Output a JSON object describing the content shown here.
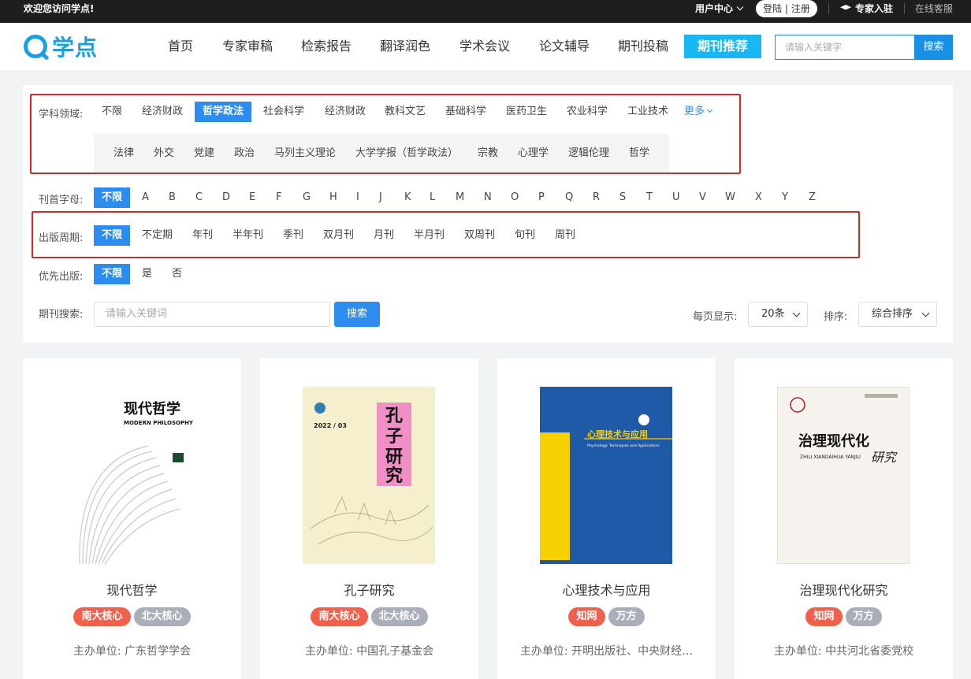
{
  "topbar": {
    "welcome": "欢迎您访问学点!",
    "user_center": "用户中心",
    "login": "登陆",
    "register": "注册",
    "expert_join": "专家入驻",
    "online_service": "在线客服"
  },
  "header": {
    "logo": "学点",
    "nav": [
      "首页",
      "专家审稿",
      "检索报告",
      "翻译润色",
      "学术会议",
      "论文辅导",
      "期刊投稿",
      "期刊推荐"
    ],
    "search_placeholder": "请输入关键字",
    "search_button": "搜索"
  },
  "filters": {
    "subject": {
      "label": "学科领域:",
      "options": [
        "不限",
        "经济财政",
        "哲学政法",
        "社会科学",
        "经济财政",
        "教科文艺",
        "基础科学",
        "医药卫生",
        "农业科学",
        "工业技术"
      ],
      "selected": "哲学政法",
      "more": "更多",
      "sub_options": [
        "法律",
        "外交",
        "党建",
        "政治",
        "马列主义理论",
        "大学学报（哲学政法）",
        "宗教",
        "心理学",
        "逻辑伦理",
        "哲学"
      ]
    },
    "initial": {
      "label": "刊首字母:",
      "options": [
        "不限",
        "A",
        "B",
        "C",
        "D",
        "E",
        "F",
        "G",
        "H",
        "I",
        "J",
        "K",
        "L",
        "M",
        "N",
        "O",
        "P",
        "Q",
        "R",
        "S",
        "T",
        "U",
        "V",
        "W",
        "X",
        "Y",
        "Z"
      ],
      "selected": "不限"
    },
    "period": {
      "label": "出版周期:",
      "options": [
        "不限",
        "不定期",
        "年刊",
        "半年刊",
        "季刊",
        "双月刊",
        "月刊",
        "半月刊",
        "双周刊",
        "旬刊",
        "周刊"
      ],
      "selected": "不限"
    },
    "priority": {
      "label": "优先出版:",
      "options": [
        "不限",
        "是",
        "否"
      ],
      "selected": "不限"
    },
    "search": {
      "label": "期刊搜索:",
      "placeholder": "请输入关键词",
      "button": "搜索"
    },
    "per_page": {
      "label": "每页显示:",
      "value": "20条"
    },
    "sort": {
      "label": "排序:",
      "value": "综合排序"
    }
  },
  "journals": [
    {
      "title": "现代哲学",
      "tags": [
        "南大核心",
        "北大核心"
      ],
      "sponsor": "主办单位:  广东哲学学会",
      "cover_title": "现代哲学",
      "cover_sub": "MODERN PHILOSOPHY"
    },
    {
      "title": "孔子研究",
      "tags": [
        "南大核心",
        "北大核心"
      ],
      "sponsor": "主办单位:  中国孔子基金会",
      "cover_title": "孔子研究",
      "cover_sub": "2022 / 03"
    },
    {
      "title": "心理技术与应用",
      "tags": [
        "知网",
        "万方"
      ],
      "sponsor": "主办单位:  开明出版社、中央财经…",
      "cover_title": "心理技术与应用",
      "cover_sub": "Psychology: Techniques and Applications"
    },
    {
      "title": "治理现代化研究",
      "tags": [
        "知网",
        "万方"
      ],
      "sponsor": "主办单位:  中共河北省委党校",
      "cover_title": "治理现代化",
      "cover_sub": "ZHILI XIANDAIHUA YANJIU"
    }
  ]
}
